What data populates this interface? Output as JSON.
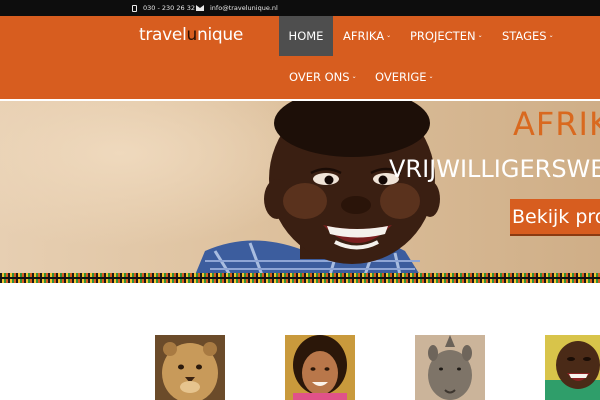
{
  "topbar": {
    "phone": "030 - 230 26 32",
    "email": "info@travelunique.nl"
  },
  "logo": {
    "part1": "travel",
    "part2": "u",
    "part3": "nique"
  },
  "nav": {
    "home": "HOME",
    "afrika": "AFRIKA",
    "projecten": "PROJECTEN",
    "stages": "STAGES",
    "over_ons": "OVER ONS",
    "overige": "OVERIGE",
    "caret": "⌄"
  },
  "hero": {
    "title": "AFRIKA",
    "subtitle": "VRIJWILLIGERSWERK",
    "cta": "Bekijk projecten"
  },
  "colors": {
    "brand_orange": "#d75d1f",
    "topbar": "#0d0d0d",
    "nav_active": "#4e4e4e"
  },
  "thumbnails": [
    {
      "subject": "lion-cub"
    },
    {
      "subject": "smiling-girl"
    },
    {
      "subject": "rhino"
    },
    {
      "subject": "laughing-child"
    }
  ]
}
